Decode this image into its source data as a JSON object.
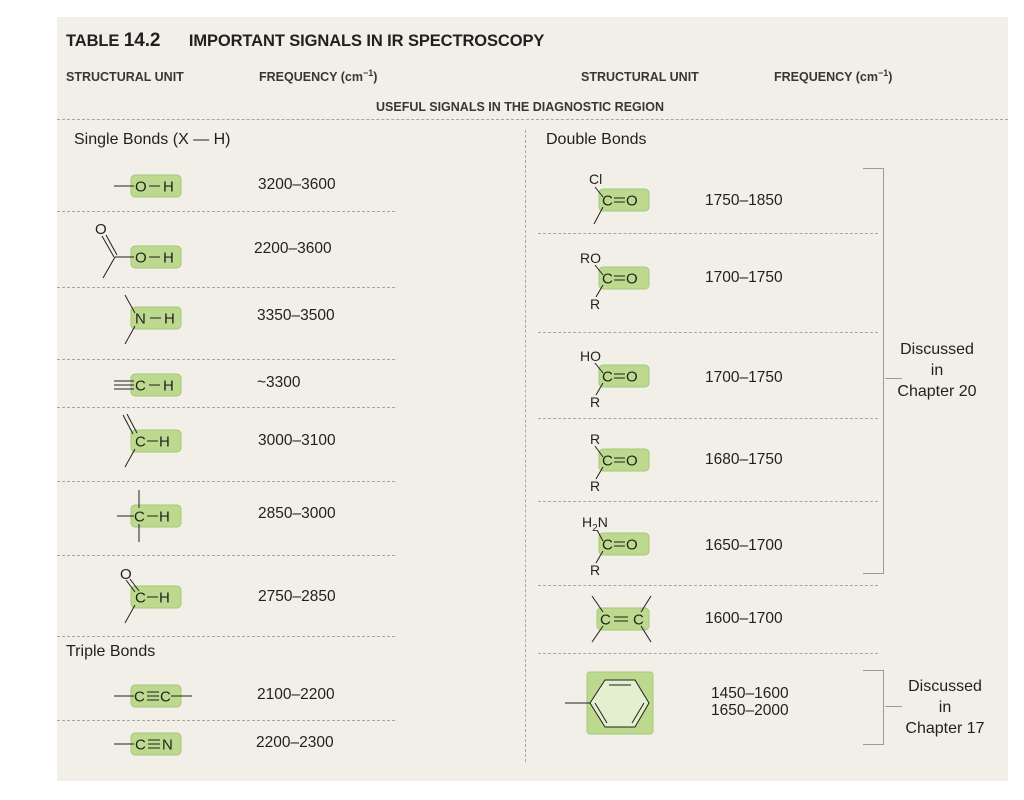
{
  "table": {
    "label": "TABLE",
    "number": "14.2",
    "title": "IMPORTANT SIGNALS IN IR SPECTROSCOPY"
  },
  "headers": {
    "structural_unit": "STRUCTURAL UNIT",
    "frequency": "FREQUENCY (cm",
    "frequency_sup": "−1",
    "frequency_close": ")",
    "region": "USEFUL SIGNALS IN THE DIAGNOSTIC REGION"
  },
  "highlight_color": "#bcd98e",
  "left_column": {
    "single_bonds_heading": "Single Bonds (X — H)",
    "single_bonds": [
      {
        "unit": "O–H (alcohol)",
        "frequency": "3200–3600"
      },
      {
        "unit": "O–H (carboxylic acid)",
        "frequency": "2200–3600"
      },
      {
        "unit": "N–H",
        "frequency": "3350–3500"
      },
      {
        "unit": "≡C–H",
        "frequency": "~3300"
      },
      {
        "unit": "=C–H",
        "frequency": "3000–3100"
      },
      {
        "unit": "sp3 C–H",
        "frequency": "2850–3000"
      },
      {
        "unit": "aldehyde C–H",
        "frequency": "2750–2850"
      }
    ],
    "triple_bonds_heading": "Triple Bonds",
    "triple_bonds": [
      {
        "unit": "C≡C",
        "frequency": "2100–2200"
      },
      {
        "unit": "C≡N",
        "frequency": "2200–2300"
      }
    ]
  },
  "right_column": {
    "double_bonds_heading": "Double Bonds",
    "double_bonds": [
      {
        "unit": "acid chloride C=O",
        "substituent_top": "Cl",
        "substituent_bottom": "",
        "frequency": "1750–1850"
      },
      {
        "unit": "ester C=O",
        "substituent_top": "RO",
        "substituent_bottom": "R",
        "frequency": "1700–1750"
      },
      {
        "unit": "carboxylic acid C=O",
        "substituent_top": "HO",
        "substituent_bottom": "R",
        "frequency": "1700–1750"
      },
      {
        "unit": "ketone C=O",
        "substituent_top": "R",
        "substituent_bottom": "R",
        "frequency": "1680–1750"
      },
      {
        "unit": "amide C=O",
        "substituent_top": "H2N",
        "substituent_bottom": "R",
        "frequency": "1650–1700"
      },
      {
        "unit": "C=C",
        "frequency": "1600–1700"
      },
      {
        "unit": "aromatic ring",
        "frequency_line1": "1450–1600",
        "frequency_line2": "1650–2000"
      }
    ],
    "notes": [
      {
        "line1": "Discussed",
        "line2": "in",
        "line3": "Chapter 20"
      },
      {
        "line1": "Discussed",
        "line2": "in",
        "line3": "Chapter 17"
      }
    ]
  },
  "atoms": {
    "O": "O",
    "H": "H",
    "N": "N",
    "C": "C",
    "R": "R",
    "Cl": "Cl",
    "RO": "RO",
    "HO": "HO",
    "H2N_H": "H",
    "H2N_2": "2",
    "H2N_N": "N"
  }
}
